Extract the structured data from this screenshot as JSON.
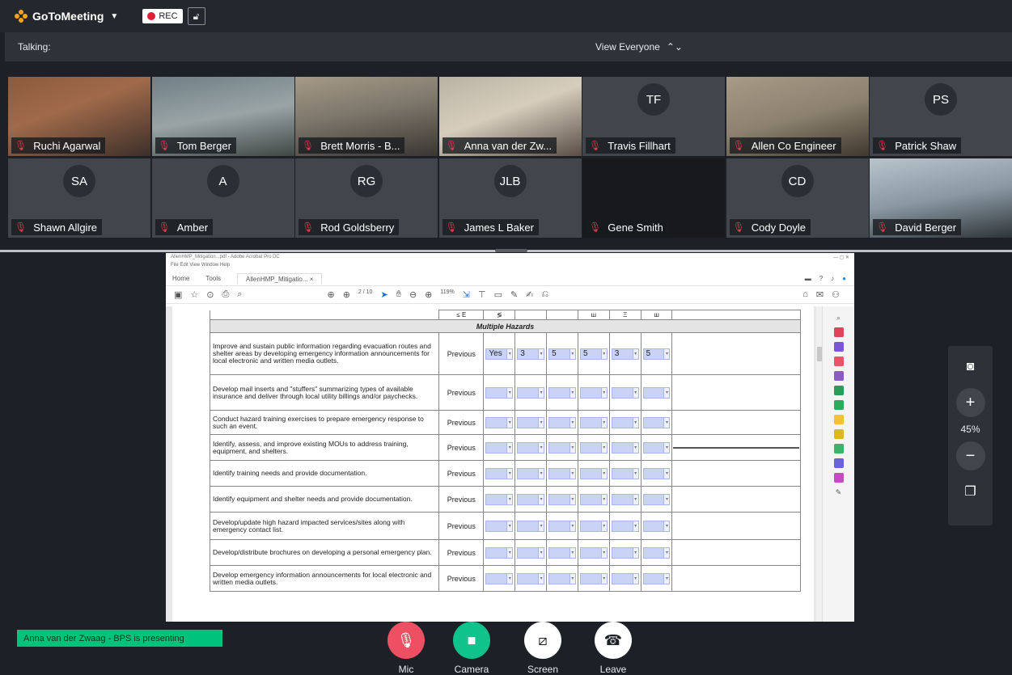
{
  "app": {
    "brand": "GoToMeeting",
    "rec_label": "REC"
  },
  "talkbar": {
    "talking_label": "Talking:",
    "view_label": "View Everyone"
  },
  "participants": [
    {
      "name": "Ruchi Agarwal",
      "initials": "",
      "video": true
    },
    {
      "name": "Tom Berger",
      "initials": "",
      "video": true
    },
    {
      "name": "Brett Morris - B...",
      "initials": "",
      "video": true
    },
    {
      "name": "Anna van der Zw...",
      "initials": "",
      "video": true
    },
    {
      "name": "Travis Fillhart",
      "initials": "TF",
      "video": false
    },
    {
      "name": "Allen Co Engineer",
      "initials": "",
      "video": true
    },
    {
      "name": "Patrick Shaw",
      "initials": "PS",
      "video": false
    },
    {
      "name": "Shawn Allgire",
      "initials": "SA",
      "video": false
    },
    {
      "name": "Amber",
      "initials": "A",
      "video": false
    },
    {
      "name": "Rod Goldsberry",
      "initials": "RG",
      "video": false
    },
    {
      "name": "James L Baker",
      "initials": "JLB",
      "video": false
    },
    {
      "name": "Gene Smith",
      "initials": "",
      "video": false
    },
    {
      "name": "Cody Doyle",
      "initials": "CD",
      "video": false
    },
    {
      "name": "David Berger",
      "initials": "",
      "video": true
    }
  ],
  "shared": {
    "menu": "File  Edit  View  Window  Help",
    "tabs": [
      "Home",
      "Tools",
      "AllenHMP_Mitigatio... ×"
    ],
    "page_info": "2 / 10",
    "zoom_info": "119%",
    "section": "Multiple Hazards",
    "header_cells": [
      "≤ E",
      "≶",
      "",
      "",
      "ш",
      "Ξ",
      "ш"
    ],
    "rows": [
      {
        "desc": "Improve and sustain public information regarding evacuation routes and shelter areas by developing emergency information announcements for local electronic and written media outlets.",
        "status": "Previous",
        "vals": [
          "Yes",
          "3",
          "5",
          "5",
          "3",
          "5"
        ]
      },
      {
        "desc": "Develop mail inserts and \"stuffers\" summarizing types of available insurance and deliver through local utility billings and/or paychecks.",
        "status": "Previous",
        "vals": [
          "",
          "",
          "",
          "",
          "",
          ""
        ]
      },
      {
        "desc": "Conduct hazard training exercises to prepare emergency response to such an event.",
        "status": "Previous",
        "vals": [
          "",
          "",
          "",
          "",
          "",
          ""
        ]
      },
      {
        "desc": "Identify, assess, and improve existing MOUs to address training, equipment, and shelters.",
        "status": "Previous",
        "vals": [
          "",
          "",
          "",
          "",
          "",
          ""
        ]
      },
      {
        "desc": "Identify training needs and provide documentation.",
        "status": "Previous",
        "vals": [
          "",
          "",
          "",
          "",
          "",
          ""
        ]
      },
      {
        "desc": "Identify equipment and shelter needs and provide documentation.",
        "status": "Previous",
        "vals": [
          "",
          "",
          "",
          "",
          "",
          ""
        ]
      },
      {
        "desc": "Develop/update high hazard impacted services/sites along with emergency contact list.",
        "status": "Previous",
        "vals": [
          "",
          "",
          "",
          "",
          "",
          ""
        ]
      },
      {
        "desc": "Develop/distribute brochures on developing a personal emergency plan.",
        "status": "Previous",
        "vals": [
          "",
          "",
          "",
          "",
          "",
          ""
        ]
      },
      {
        "desc": "Develop emergency information announcements for local electronic and written media outlets.",
        "status": "Previous",
        "vals": [
          "",
          "",
          "",
          "",
          "",
          ""
        ]
      }
    ]
  },
  "zoom": {
    "level": "45%"
  },
  "presenting": "Anna van der Zwaag - BPS is presenting",
  "controls": {
    "mic": "Mic",
    "camera": "Camera",
    "screen": "Screen",
    "leave": "Leave"
  },
  "colors": {
    "accent": "#00c27a",
    "danger": "#e0364a",
    "brand": "#f7a21b"
  }
}
